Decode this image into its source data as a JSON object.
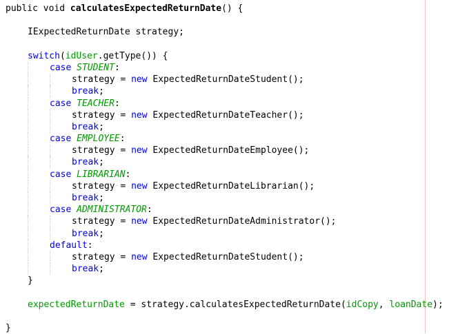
{
  "editor": {
    "margin_line_color": "#f2c2c2",
    "guide_color": "#c8c8c8",
    "colors": {
      "keyword": "#0000e6",
      "field": "#009900",
      "text": "#000000"
    }
  },
  "code": {
    "lines": [
      {
        "indent": 0,
        "tokens": [
          {
            "t": "public void ",
            "c": "kw-plain"
          },
          {
            "t": "calculatesExpectedReturnDate",
            "c": "bold"
          },
          {
            "t": "() {",
            "c": ""
          }
        ]
      },
      {
        "indent": 0,
        "tokens": []
      },
      {
        "indent": 1,
        "tokens": [
          {
            "t": "IExpectedReturnDate strategy;",
            "c": ""
          }
        ]
      },
      {
        "indent": 0,
        "tokens": []
      },
      {
        "indent": 1,
        "tokens": [
          {
            "t": "switch",
            "c": "kw"
          },
          {
            "t": "(",
            "c": ""
          },
          {
            "t": "idUser",
            "c": "ident-green"
          },
          {
            "t": ".getType()) {",
            "c": ""
          }
        ]
      },
      {
        "indent": 2,
        "tokens": [
          {
            "t": "case ",
            "c": "kw"
          },
          {
            "t": "STUDENT",
            "c": "enum"
          },
          {
            "t": ":",
            "c": ""
          }
        ]
      },
      {
        "indent": 3,
        "tokens": [
          {
            "t": "strategy = ",
            "c": ""
          },
          {
            "t": "new ",
            "c": "kw"
          },
          {
            "t": "ExpectedReturnDateStudent();",
            "c": ""
          }
        ]
      },
      {
        "indent": 3,
        "tokens": [
          {
            "t": "break",
            "c": "kw"
          },
          {
            "t": ";",
            "c": ""
          }
        ]
      },
      {
        "indent": 2,
        "tokens": [
          {
            "t": "case ",
            "c": "kw"
          },
          {
            "t": "TEACHER",
            "c": "enum"
          },
          {
            "t": ":",
            "c": ""
          }
        ]
      },
      {
        "indent": 3,
        "tokens": [
          {
            "t": "strategy = ",
            "c": ""
          },
          {
            "t": "new ",
            "c": "kw"
          },
          {
            "t": "ExpectedReturnDateTeacher();",
            "c": ""
          }
        ]
      },
      {
        "indent": 3,
        "tokens": [
          {
            "t": "break",
            "c": "kw"
          },
          {
            "t": ";",
            "c": ""
          }
        ]
      },
      {
        "indent": 2,
        "tokens": [
          {
            "t": "case ",
            "c": "kw"
          },
          {
            "t": "EMPLOYEE",
            "c": "enum"
          },
          {
            "t": ":",
            "c": ""
          }
        ]
      },
      {
        "indent": 3,
        "tokens": [
          {
            "t": "strategy = ",
            "c": ""
          },
          {
            "t": "new ",
            "c": "kw"
          },
          {
            "t": "ExpectedReturnDateEmployee();",
            "c": ""
          }
        ]
      },
      {
        "indent": 3,
        "tokens": [
          {
            "t": "break",
            "c": "kw"
          },
          {
            "t": ";",
            "c": ""
          }
        ]
      },
      {
        "indent": 2,
        "tokens": [
          {
            "t": "case ",
            "c": "kw"
          },
          {
            "t": "LIBRARIAN",
            "c": "enum"
          },
          {
            "t": ":",
            "c": ""
          }
        ]
      },
      {
        "indent": 3,
        "tokens": [
          {
            "t": "strategy = ",
            "c": ""
          },
          {
            "t": "new ",
            "c": "kw"
          },
          {
            "t": "ExpectedReturnDateLibrarian();",
            "c": ""
          }
        ]
      },
      {
        "indent": 3,
        "tokens": [
          {
            "t": "break",
            "c": "kw"
          },
          {
            "t": ";",
            "c": ""
          }
        ]
      },
      {
        "indent": 2,
        "tokens": [
          {
            "t": "case ",
            "c": "kw"
          },
          {
            "t": "ADMINISTRATOR",
            "c": "enum"
          },
          {
            "t": ":",
            "c": ""
          }
        ]
      },
      {
        "indent": 3,
        "tokens": [
          {
            "t": "strategy = ",
            "c": ""
          },
          {
            "t": "new ",
            "c": "kw"
          },
          {
            "t": "ExpectedReturnDateAdministrator();",
            "c": ""
          }
        ]
      },
      {
        "indent": 3,
        "tokens": [
          {
            "t": "break",
            "c": "kw"
          },
          {
            "t": ";",
            "c": ""
          }
        ]
      },
      {
        "indent": 2,
        "tokens": [
          {
            "t": "default",
            "c": "kw"
          },
          {
            "t": ":",
            "c": ""
          }
        ]
      },
      {
        "indent": 3,
        "tokens": [
          {
            "t": "strategy = ",
            "c": ""
          },
          {
            "t": "new ",
            "c": "kw"
          },
          {
            "t": "ExpectedReturnDateStudent();",
            "c": ""
          }
        ]
      },
      {
        "indent": 3,
        "tokens": [
          {
            "t": "break",
            "c": "kw"
          },
          {
            "t": ";",
            "c": ""
          }
        ]
      },
      {
        "indent": 1,
        "tokens": [
          {
            "t": "}",
            "c": ""
          }
        ]
      },
      {
        "indent": 0,
        "tokens": []
      },
      {
        "indent": 1,
        "tokens": [
          {
            "t": "expectedReturnDate",
            "c": "ident-green"
          },
          {
            "t": " = strategy.calculatesExpectedReturnDate(",
            "c": ""
          },
          {
            "t": "idCopy",
            "c": "ident-green"
          },
          {
            "t": ", ",
            "c": ""
          },
          {
            "t": "loanDate",
            "c": "ident-green"
          },
          {
            "t": ");",
            "c": ""
          }
        ]
      },
      {
        "indent": 0,
        "tokens": []
      },
      {
        "indent": 0,
        "tokens": [
          {
            "t": "}",
            "c": ""
          }
        ]
      }
    ]
  }
}
